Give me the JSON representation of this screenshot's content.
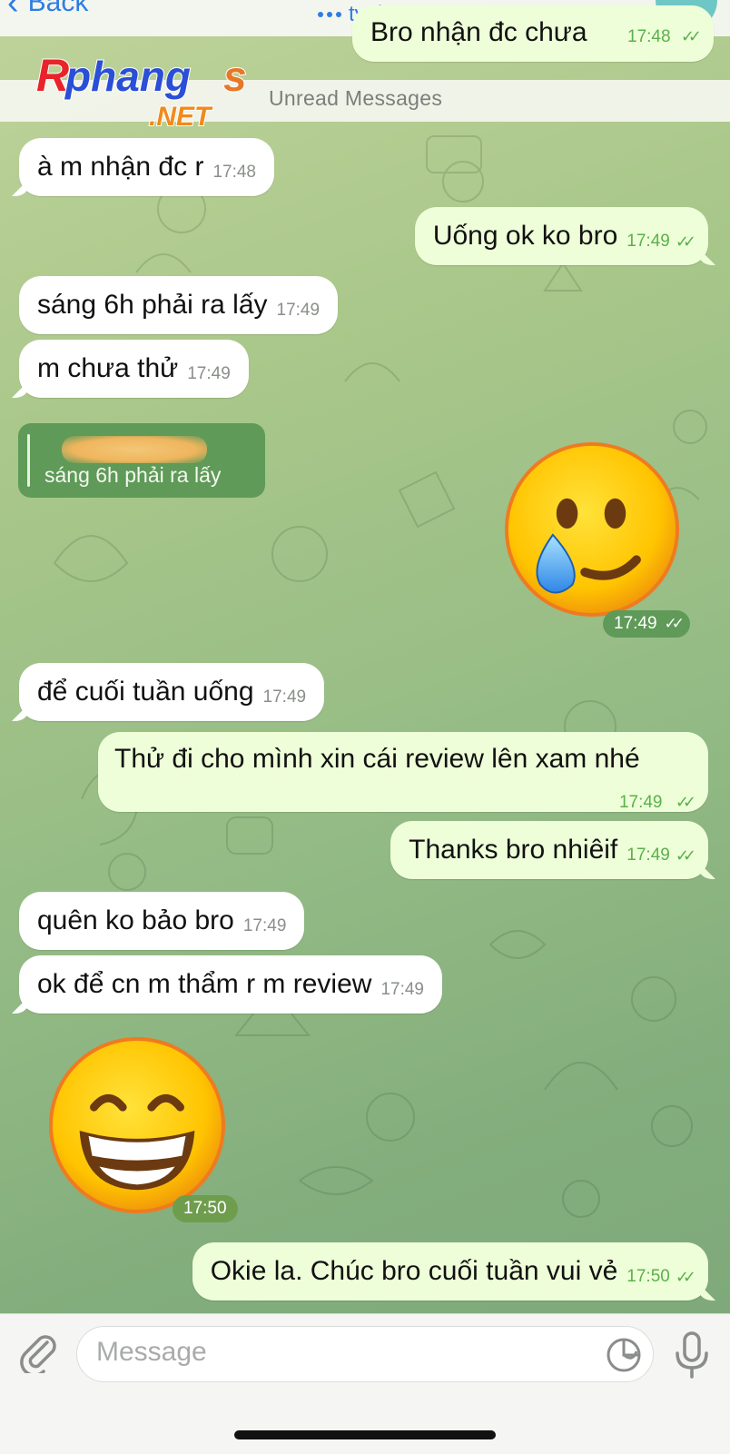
{
  "header": {
    "back_label": "Back",
    "status": "typing"
  },
  "watermark": {
    "brand": "Rphangs",
    "suffix": ".NET"
  },
  "unread_label": "Unread Messages",
  "partial_top_message": {
    "text": "Bro nhận đc chưa",
    "time": "17:48"
  },
  "messages": [
    {
      "dir": "in",
      "text": "à m nhận đc r",
      "time": "17:48"
    },
    {
      "dir": "out",
      "text": "Uống ok ko bro",
      "time": "17:49"
    },
    {
      "dir": "in",
      "text": "sáng 6h phải ra lấy",
      "time": "17:49"
    },
    {
      "dir": "in",
      "text": "m chưa thử",
      "time": "17:49"
    },
    {
      "dir": "in",
      "text": "để cuối tuần uống",
      "time": "17:49"
    },
    {
      "dir": "out",
      "text": "Thử đi cho mình xin cái review lên xam nhé",
      "time": "17:49"
    },
    {
      "dir": "out",
      "text": "Thanks bro nhiêif",
      "time": "17:49"
    },
    {
      "dir": "in",
      "text": "quên ko bảo bro",
      "time": "17:49"
    },
    {
      "dir": "in",
      "text": "ok để cn m thẩm r m review",
      "time": "17:49"
    },
    {
      "dir": "out",
      "text": "Okie la. Chúc bro cuối tuần vui vẻ",
      "time": "17:50"
    }
  ],
  "reply_preview": {
    "quoted_text": "sáng 6h phải ra lấy"
  },
  "stickers": [
    {
      "icon": "crying-smile-emoji-icon",
      "time": "17:49",
      "dir": "out"
    },
    {
      "icon": "grinning-emoji-icon",
      "time": "17:50",
      "dir": "in"
    }
  ],
  "input": {
    "placeholder": "Message"
  },
  "icons": {
    "attach": "paperclip-icon",
    "sticker": "sticker-icon",
    "mic": "microphone-icon",
    "read_receipt": "double-check-icon"
  },
  "colors": {
    "accent": "#2f7de1",
    "outgoing_bubble": "#eefed8",
    "incoming_bubble": "#ffffff",
    "read_tick": "#5ab14c",
    "reply_box": "#5f9a58"
  }
}
